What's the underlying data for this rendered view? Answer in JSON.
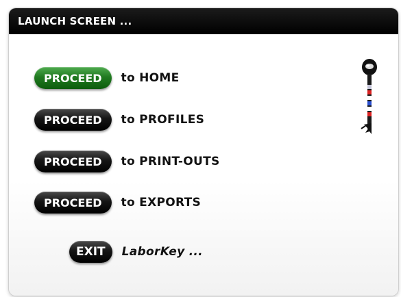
{
  "window": {
    "title": "LAUNCH SCREEN ..."
  },
  "actions": [
    {
      "button": "PROCEED",
      "label": "to HOME",
      "accent": "#217a21"
    },
    {
      "button": "PROCEED",
      "label": "to PROFILES",
      "accent": "#000000"
    },
    {
      "button": "PROCEED",
      "label": "to PRINT-OUTS",
      "accent": "#000000"
    },
    {
      "button": "PROCEED",
      "label": "to EXPORTS",
      "accent": "#000000"
    }
  ],
  "exit": {
    "button": "EXIT",
    "label": "LaborKey ..."
  },
  "icons": {
    "key": "key-icon"
  }
}
